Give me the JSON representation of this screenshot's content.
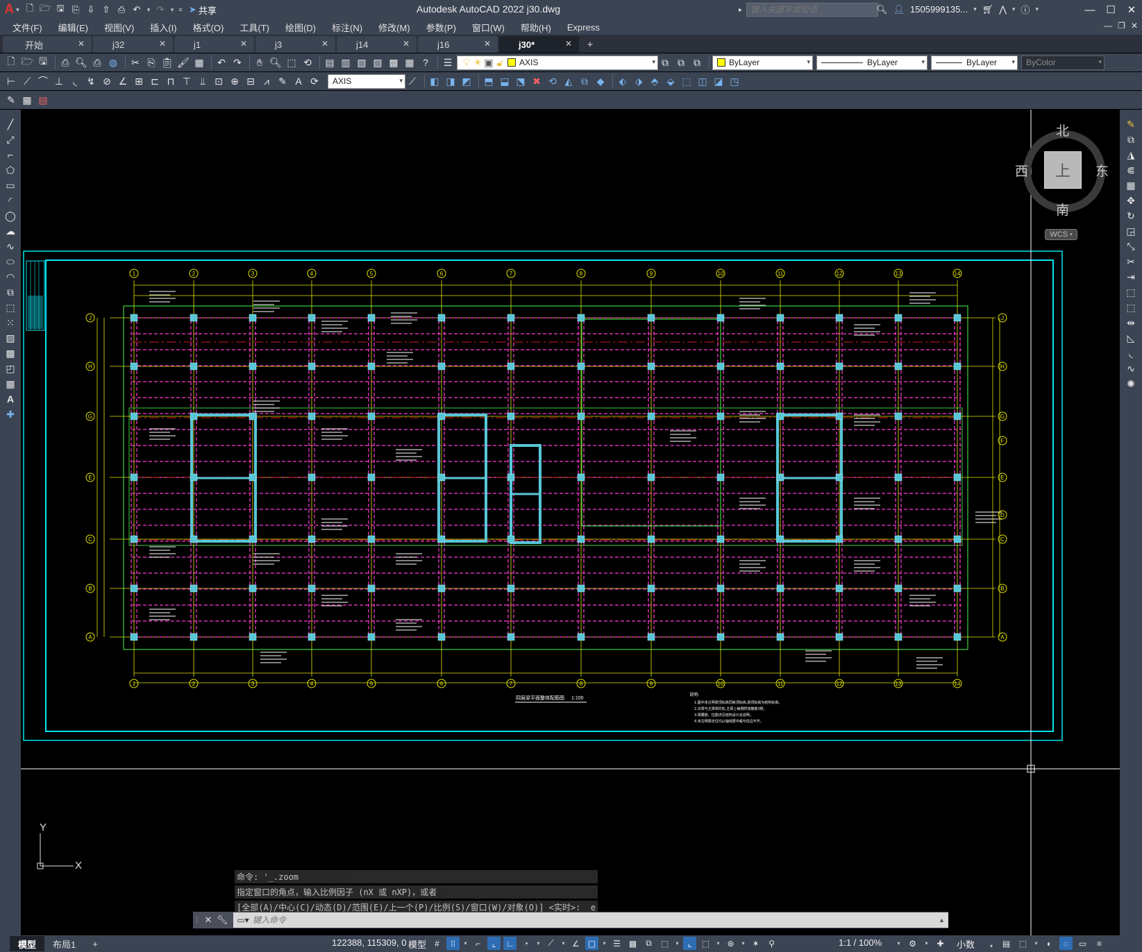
{
  "titlebar": {
    "app_logo": "A",
    "app_title": "Autodesk AutoCAD 2022    j30.dwg",
    "share_label": "共享",
    "search_placeholder": "键入关键字或短语",
    "user": "1505999135...",
    "quick_access_icons": [
      "new-icon",
      "open-icon",
      "save-icon",
      "save-as-icon",
      "open-from-web-icon",
      "save-to-web-icon",
      "plot-icon",
      "undo-icon",
      "redo-icon",
      "customize-icon"
    ]
  },
  "menubar": {
    "items": [
      "文件(F)",
      "编辑(E)",
      "视图(V)",
      "插入(I)",
      "格式(O)",
      "工具(T)",
      "绘图(D)",
      "标注(N)",
      "修改(M)",
      "参数(P)",
      "窗口(W)",
      "帮助(H)",
      "Express"
    ]
  },
  "tabs": {
    "items": [
      {
        "label": "开始",
        "active": false
      },
      {
        "label": "j32",
        "active": false
      },
      {
        "label": "j1",
        "active": false
      },
      {
        "label": "j3",
        "active": false
      },
      {
        "label": "j14",
        "active": false
      },
      {
        "label": "j16",
        "active": false
      },
      {
        "label": "j30*",
        "active": true
      }
    ],
    "add_label": "+"
  },
  "toolbars": {
    "layer_combo": "AXIS",
    "layer_swatch_color": "#ffff00",
    "color_combo": "ByLayer",
    "linetype_combo": "ByLayer",
    "lineweight_combo": "ByLayer",
    "plotstyle_combo": "ByColor",
    "dimstyle_combo": "AXIS"
  },
  "viewcube": {
    "north": "北",
    "south": "南",
    "east": "东",
    "west": "西",
    "top": "上",
    "wcs": "WCS"
  },
  "drawing": {
    "axis_numbers": [
      "1",
      "2",
      "3",
      "4",
      "5",
      "6",
      "7",
      "8",
      "9",
      "10",
      "11",
      "12",
      "13",
      "14"
    ],
    "axis_letters": [
      "J",
      "H",
      "G",
      "E",
      "C",
      "B",
      "A"
    ],
    "axis_letters_right": [
      "J",
      "H",
      "G",
      "F",
      "E",
      "D",
      "C",
      "B",
      "A"
    ],
    "title": "四层梁平面整体配筋图",
    "scale": "1:100",
    "notes_title": "说明:",
    "notes": [
      "1.图中未注明梁顶标高同板顶标高,梁顶标高为结构标高。",
      "2.次梁与主梁相交处,主梁上每侧附加箍筋3根。",
      "3.梁腰筋、拉筋详见结构设计总说明。",
      "4.未注明梁定位均以轴线居中或与柱边平齐。"
    ]
  },
  "ucs": {
    "y_label": "Y",
    "x_label": "X"
  },
  "command": {
    "history": [
      "命令: '_.zoom",
      "指定窗口的角点，输入比例因子 (nX 或 nXP)，或者",
      "[全部(A)/中心(C)/动态(D)/范围(E)/上一个(P)/比例(S)/窗口(W)/对象(O)] <实时>: _e"
    ],
    "placeholder": "键入命令"
  },
  "statusbar": {
    "layout_tabs": [
      {
        "label": "模型",
        "active": true
      },
      {
        "label": "布局1",
        "active": false
      }
    ],
    "add_label": "+",
    "coords": "122388, 115309, 0",
    "model_label": "模型",
    "scale": "1:1 / 100%",
    "units": "小数"
  },
  "colors": {
    "ui_bg": "#3b4453",
    "canvas_bg": "#000000",
    "frame_cyan": "#00e5ee",
    "axis_yellow": "#e6e600",
    "beam_magenta": "#ff3cd0",
    "wall_green": "#3dd13d",
    "column_cyan": "#59c6d6",
    "accent_blue": "#2e6db4"
  }
}
